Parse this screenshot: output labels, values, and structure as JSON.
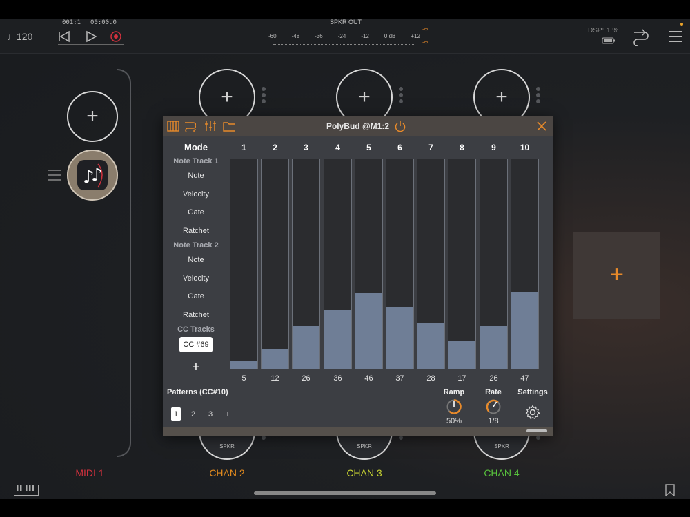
{
  "transport": {
    "tempo": "♩120",
    "position": "001:1",
    "time": "00:00.0",
    "meter_title": "SPKR OUT",
    "meter_ticks": [
      "-60",
      "-48",
      "-36",
      "-24",
      "-12",
      "0 dB",
      "+12"
    ],
    "meter_peak_top": "-∞",
    "meter_peak_bottom": "-∞",
    "dsp": "DSP:",
    "dsp_value": "1 %"
  },
  "channels": {
    "midi1": {
      "label": "MIDI 1",
      "color": "#d0313d"
    },
    "chan2": {
      "label": "CHAN 2",
      "color": "#e28a1e",
      "out": "SPKR"
    },
    "chan3": {
      "label": "CHAN 3",
      "color": "#c6d132",
      "out": "SPKR"
    },
    "chan4": {
      "label": "CHAN 4",
      "color": "#58c33d",
      "out": "SPKR"
    }
  },
  "plugin": {
    "title": "PolyBud @M1:2",
    "mode_header": "Mode",
    "steps": [
      "1",
      "2",
      "3",
      "4",
      "5",
      "6",
      "7",
      "8",
      "9",
      "10"
    ],
    "rows": [
      {
        "label": "Note Track 1",
        "section": true
      },
      {
        "label": "Note"
      },
      {
        "label": "Velocity"
      },
      {
        "label": "Gate"
      },
      {
        "label": "Ratchet"
      },
      {
        "label": "Note Track 2",
        "section": true
      },
      {
        "label": "Note"
      },
      {
        "label": "Velocity"
      },
      {
        "label": "Gate"
      },
      {
        "label": "Ratchet"
      },
      {
        "label": "CC Tracks",
        "section": true
      }
    ],
    "selected_track": "CC #69",
    "add_track": "+",
    "values": [
      5,
      12,
      26,
      36,
      46,
      37,
      28,
      17,
      26,
      47
    ],
    "value_max": 127,
    "patterns_label": "Patterns (CC#10)",
    "patterns": [
      "1",
      "2",
      "3"
    ],
    "pattern_add": "+",
    "active_pattern": "1",
    "ramp_label": "Ramp",
    "ramp_value": "50%",
    "rate_label": "Rate",
    "rate_value": "1/8",
    "settings_label": "Settings",
    "accent": "#e88a2a"
  }
}
